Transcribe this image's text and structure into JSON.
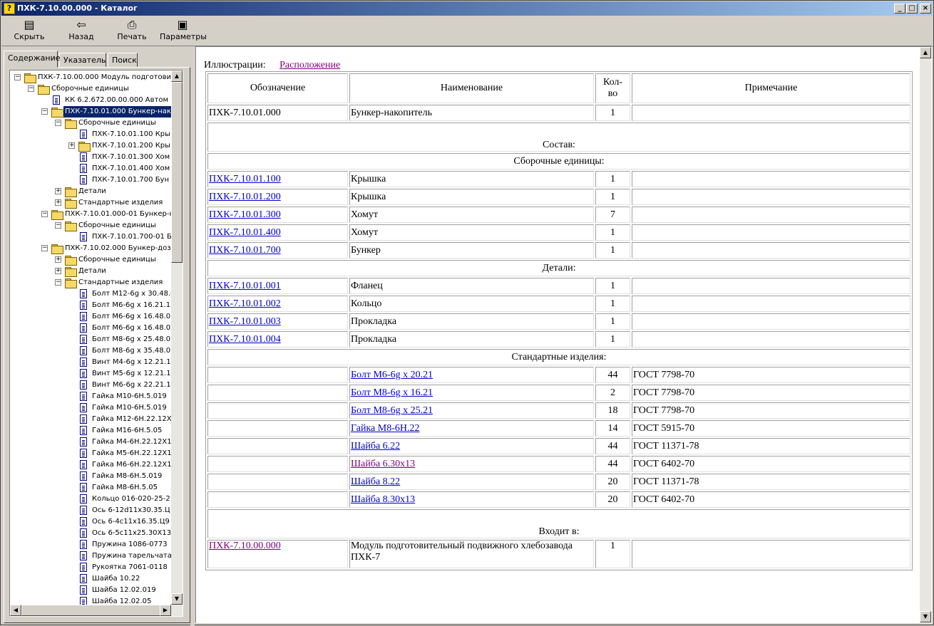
{
  "window": {
    "title": "ПХК-7.10.00.000 - Каталог",
    "min": "_",
    "max": "□",
    "close": "×"
  },
  "toolbar": {
    "hide": "Скрыть",
    "back": "Назад",
    "print": "Печать",
    "options": "Параметры"
  },
  "tabs": [
    "Содержание",
    "Указатель",
    "Поиск"
  ],
  "tree": [
    {
      "text": "ПХК-7.10.00.000  Модуль подготови",
      "level": 0,
      "icon": "folder",
      "exp": "-"
    },
    {
      "text": "Сборочные единицы",
      "level": 1,
      "icon": "folder",
      "exp": "-"
    },
    {
      "text": "КК 6.2.672.00.00.000  Автом",
      "level": 2,
      "icon": "doc",
      "exp": ""
    },
    {
      "text": "ПХК-7.10.01.000  Бункер-нак",
      "level": 2,
      "icon": "folder",
      "exp": "-",
      "selected": true
    },
    {
      "text": "Сборочные единицы",
      "level": 3,
      "icon": "folder",
      "exp": "-"
    },
    {
      "text": "ПХК-7.10.01.100  Кры",
      "level": 4,
      "icon": "doc",
      "exp": ""
    },
    {
      "text": "ПХК-7.10.01.200  Кры",
      "level": 4,
      "icon": "folder",
      "exp": "+"
    },
    {
      "text": "ПХК-7.10.01.300  Хом",
      "level": 4,
      "icon": "doc",
      "exp": ""
    },
    {
      "text": "ПХК-7.10.01.400  Хом",
      "level": 4,
      "icon": "doc",
      "exp": ""
    },
    {
      "text": "ПХК-7.10.01.700  Бун",
      "level": 4,
      "icon": "doc",
      "exp": ""
    },
    {
      "text": "Детали",
      "level": 3,
      "icon": "folder",
      "exp": "+"
    },
    {
      "text": "Стандартные изделия",
      "level": 3,
      "icon": "folder",
      "exp": "+"
    },
    {
      "text": "ПХК-7.10.01.000-01  Бункер-н",
      "level": 2,
      "icon": "folder",
      "exp": "-"
    },
    {
      "text": "Сборочные единицы",
      "level": 3,
      "icon": "folder",
      "exp": "-"
    },
    {
      "text": "ПХК-7.10.01.700-01  Б",
      "level": 4,
      "icon": "doc",
      "exp": ""
    },
    {
      "text": "ПХК-7.10.02.000  Бункер-доз",
      "level": 2,
      "icon": "folder",
      "exp": "-"
    },
    {
      "text": "Сборочные единицы",
      "level": 3,
      "icon": "folder",
      "exp": "+"
    },
    {
      "text": "Детали",
      "level": 3,
      "icon": "folder",
      "exp": "+"
    },
    {
      "text": "Стандартные изделия",
      "level": 3,
      "icon": "folder",
      "exp": "-"
    },
    {
      "text": "Болт М12-6g x 30.48.0",
      "level": 4,
      "icon": "doc",
      "exp": ""
    },
    {
      "text": "Болт М6-6g x 16.21.1",
      "level": 4,
      "icon": "doc",
      "exp": ""
    },
    {
      "text": "Болт М6-6g x 16.48.0",
      "level": 4,
      "icon": "doc",
      "exp": ""
    },
    {
      "text": "Болт М6-6g x 16.48.0",
      "level": 4,
      "icon": "doc",
      "exp": ""
    },
    {
      "text": "Болт М8-6g x 25.48.0",
      "level": 4,
      "icon": "doc",
      "exp": ""
    },
    {
      "text": "Болт М8-6g x 35.48.0",
      "level": 4,
      "icon": "doc",
      "exp": ""
    },
    {
      "text": "Винт М4-6g x 12.21.1",
      "level": 4,
      "icon": "doc",
      "exp": ""
    },
    {
      "text": "Винт М5-6g x 12.21.1",
      "level": 4,
      "icon": "doc",
      "exp": ""
    },
    {
      "text": "Винт М6-6g x 22.21.1",
      "level": 4,
      "icon": "doc",
      "exp": ""
    },
    {
      "text": "Гайка М10-6Н.5.019",
      "level": 4,
      "icon": "doc",
      "exp": ""
    },
    {
      "text": "Гайка М10-6Н.5.019",
      "level": 4,
      "icon": "doc",
      "exp": ""
    },
    {
      "text": "Гайка М12-6Н.22.12Х",
      "level": 4,
      "icon": "doc",
      "exp": ""
    },
    {
      "text": "Гайка М16-6Н.5.05",
      "level": 4,
      "icon": "doc",
      "exp": ""
    },
    {
      "text": "Гайка М4-6Н.22.12Х1",
      "level": 4,
      "icon": "doc",
      "exp": ""
    },
    {
      "text": "Гайка М5-6Н.22.12Х1",
      "level": 4,
      "icon": "doc",
      "exp": ""
    },
    {
      "text": "Гайка М6-6Н.22.12Х1",
      "level": 4,
      "icon": "doc",
      "exp": ""
    },
    {
      "text": "Гайка М8-6Н.5.019",
      "level": 4,
      "icon": "doc",
      "exp": ""
    },
    {
      "text": "Гайка М8-6Н.5.05",
      "level": 4,
      "icon": "doc",
      "exp": ""
    },
    {
      "text": "Кольцо 016-020-25-2",
      "level": 4,
      "icon": "doc",
      "exp": ""
    },
    {
      "text": "Ось 6-12d11x30.35.Ц",
      "level": 4,
      "icon": "doc",
      "exp": ""
    },
    {
      "text": "Ось 6-4с11х16.35.Ц9",
      "level": 4,
      "icon": "doc",
      "exp": ""
    },
    {
      "text": "Ось 6-5с11х25.30Х13",
      "level": 4,
      "icon": "doc",
      "exp": ""
    },
    {
      "text": "Пружина 1086-0773",
      "level": 4,
      "icon": "doc",
      "exp": ""
    },
    {
      "text": "Пружина тарельчата",
      "level": 4,
      "icon": "doc",
      "exp": ""
    },
    {
      "text": "Рукоятка 7061-0118",
      "level": 4,
      "icon": "doc",
      "exp": ""
    },
    {
      "text": "Шайба 10.22",
      "level": 4,
      "icon": "doc",
      "exp": ""
    },
    {
      "text": "Шайба 12.02.019",
      "level": 4,
      "icon": "doc",
      "exp": ""
    },
    {
      "text": "Шайба 12.02.05",
      "level": 4,
      "icon": "doc",
      "exp": ""
    }
  ],
  "content": {
    "ill_label": "Иллюстрации:",
    "ill_link": "Расположение",
    "headers": [
      "Обозначение",
      "Наименование",
      "Кол-во",
      "Примечание"
    ],
    "main_row": {
      "code": "ПХК-7.10.01.000",
      "name": "Бункер-накопитель",
      "qty": "1",
      "note": ""
    },
    "composition_label": "Состав:",
    "sections": [
      {
        "title": "Сборочные единицы:",
        "rows": [
          {
            "code": "ПХК-7.10.01.100",
            "name": "Крышка",
            "qty": "1",
            "note": ""
          },
          {
            "code": "ПХК-7.10.01.200",
            "name": "Крышка",
            "qty": "1",
            "note": ""
          },
          {
            "code": "ПХК-7.10.01.300",
            "name": "Хомут",
            "qty": "7",
            "note": ""
          },
          {
            "code": "ПХК-7.10.01.400",
            "name": "Хомут",
            "qty": "1",
            "note": ""
          },
          {
            "code": "ПХК-7.10.01.700",
            "name": "Бункер",
            "qty": "1",
            "note": ""
          }
        ]
      },
      {
        "title": "Детали:",
        "rows": [
          {
            "code": "ПХК-7.10.01.001",
            "name": "Фланец",
            "qty": "1",
            "note": ""
          },
          {
            "code": "ПХК-7.10.01.002",
            "name": "Кольцо",
            "qty": "1",
            "note": ""
          },
          {
            "code": "ПХК-7.10.01.003",
            "name": "Прокладка",
            "qty": "1",
            "note": ""
          },
          {
            "code": "ПХК-7.10.01.004",
            "name": "Прокладка",
            "qty": "1",
            "note": ""
          }
        ]
      },
      {
        "title": "Стандартные изделия:",
        "rows": [
          {
            "code": "",
            "name": "Болт М6-6g x 20.21",
            "qty": "44",
            "note": "ГОСТ 7798-70",
            "name_link": true
          },
          {
            "code": "",
            "name": "Болт М8-6g x 16.21",
            "qty": "2",
            "note": "ГОСТ 7798-70",
            "name_link": true
          },
          {
            "code": "",
            "name": "Болт М8-6g x 25.21",
            "qty": "18",
            "note": "ГОСТ 7798-70",
            "name_link": true
          },
          {
            "code": "",
            "name": "Гайка М8-6Н.22",
            "qty": "14",
            "note": "ГОСТ 5915-70",
            "name_link": true
          },
          {
            "code": "",
            "name": "Шайба 6.22",
            "qty": "44",
            "note": "ГОСТ 11371-78",
            "name_link": true
          },
          {
            "code": "",
            "name": "Шайба 6.30х13",
            "qty": "44",
            "note": "ГОСТ 6402-70",
            "name_link": true,
            "visited": true
          },
          {
            "code": "",
            "name": "Шайба 8.22",
            "qty": "20",
            "note": "ГОСТ 11371-78",
            "name_link": true
          },
          {
            "code": "",
            "name": "Шайба 8.30х13",
            "qty": "20",
            "note": "ГОСТ 6402-70",
            "name_link": true
          }
        ]
      }
    ],
    "included_label": "Входит в:",
    "included": [
      {
        "code": "ПХК-7.10.00.000",
        "name": "Модуль подготовительный подвижного хлебозавода ПХК-7",
        "qty": "1",
        "note": ""
      }
    ]
  },
  "colors": {
    "link": "#0000cc",
    "visited": "#800080",
    "selection": "#0a246a",
    "titlebar": "#0a246a"
  },
  "icons": [
    "app-help-icon",
    "hide-icon",
    "back-arrow-icon",
    "printer-icon",
    "options-icon",
    "folder-icon",
    "document-icon"
  ]
}
